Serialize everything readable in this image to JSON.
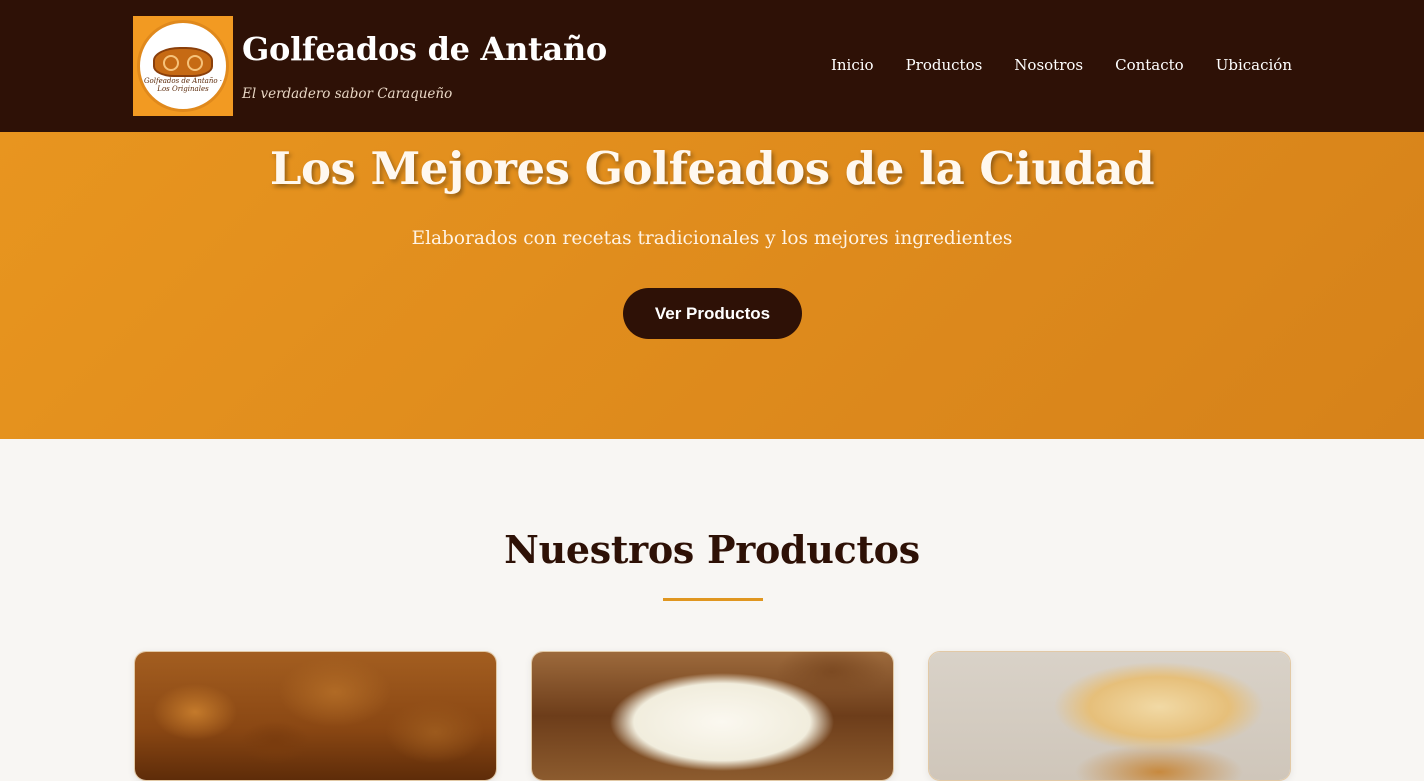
{
  "header": {
    "logo_text": "Golfeados de Antaño · Los Originales",
    "brand_title": "Golfeados de Antaño",
    "tagline": "El verdadero sabor Caraqueño",
    "nav": [
      "Inicio",
      "Productos",
      "Nosotros",
      "Contacto",
      "Ubicación"
    ]
  },
  "hero": {
    "title": "Los Mejores Golfeados de la Ciudad",
    "subtitle": "Elaborados con recetas tradicionales y los mejores ingredientes",
    "button": "Ver Productos"
  },
  "products": {
    "title": "Nuestros Productos"
  },
  "colors": {
    "header_bg": "#2e1106",
    "hero_bg": "#e0891c",
    "accent": "#e0961f",
    "page_bg": "#f8f6f3"
  }
}
